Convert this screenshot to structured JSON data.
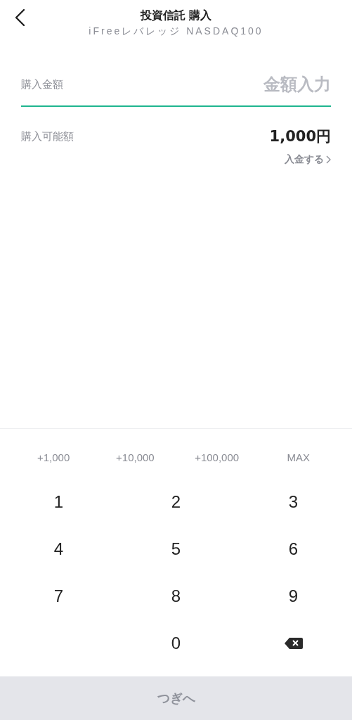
{
  "header": {
    "title": "投資信託 購入",
    "subtitle": "iFreeレバレッジ NASDAQ100"
  },
  "amount_field": {
    "label": "購入金額",
    "placeholder": "金額入力",
    "focused": true
  },
  "available": {
    "label": "購入可能額",
    "value": "1,000円",
    "link": "入金する"
  },
  "quick_amounts": [
    "+1,000",
    "+10,000",
    "+100,000",
    "MAX"
  ],
  "keys": [
    {
      "kind": "digit",
      "label": "1"
    },
    {
      "kind": "digit",
      "label": "2"
    },
    {
      "kind": "digit",
      "label": "3"
    },
    {
      "kind": "digit",
      "label": "4"
    },
    {
      "kind": "digit",
      "label": "5"
    },
    {
      "kind": "digit",
      "label": "6"
    },
    {
      "kind": "digit",
      "label": "7"
    },
    {
      "kind": "digit",
      "label": "8"
    },
    {
      "kind": "digit",
      "label": "9"
    },
    {
      "kind": "blank"
    },
    {
      "kind": "digit",
      "label": "0"
    },
    {
      "kind": "backspace"
    }
  ],
  "next_button": {
    "label": "つぎへ",
    "disabled": true
  }
}
